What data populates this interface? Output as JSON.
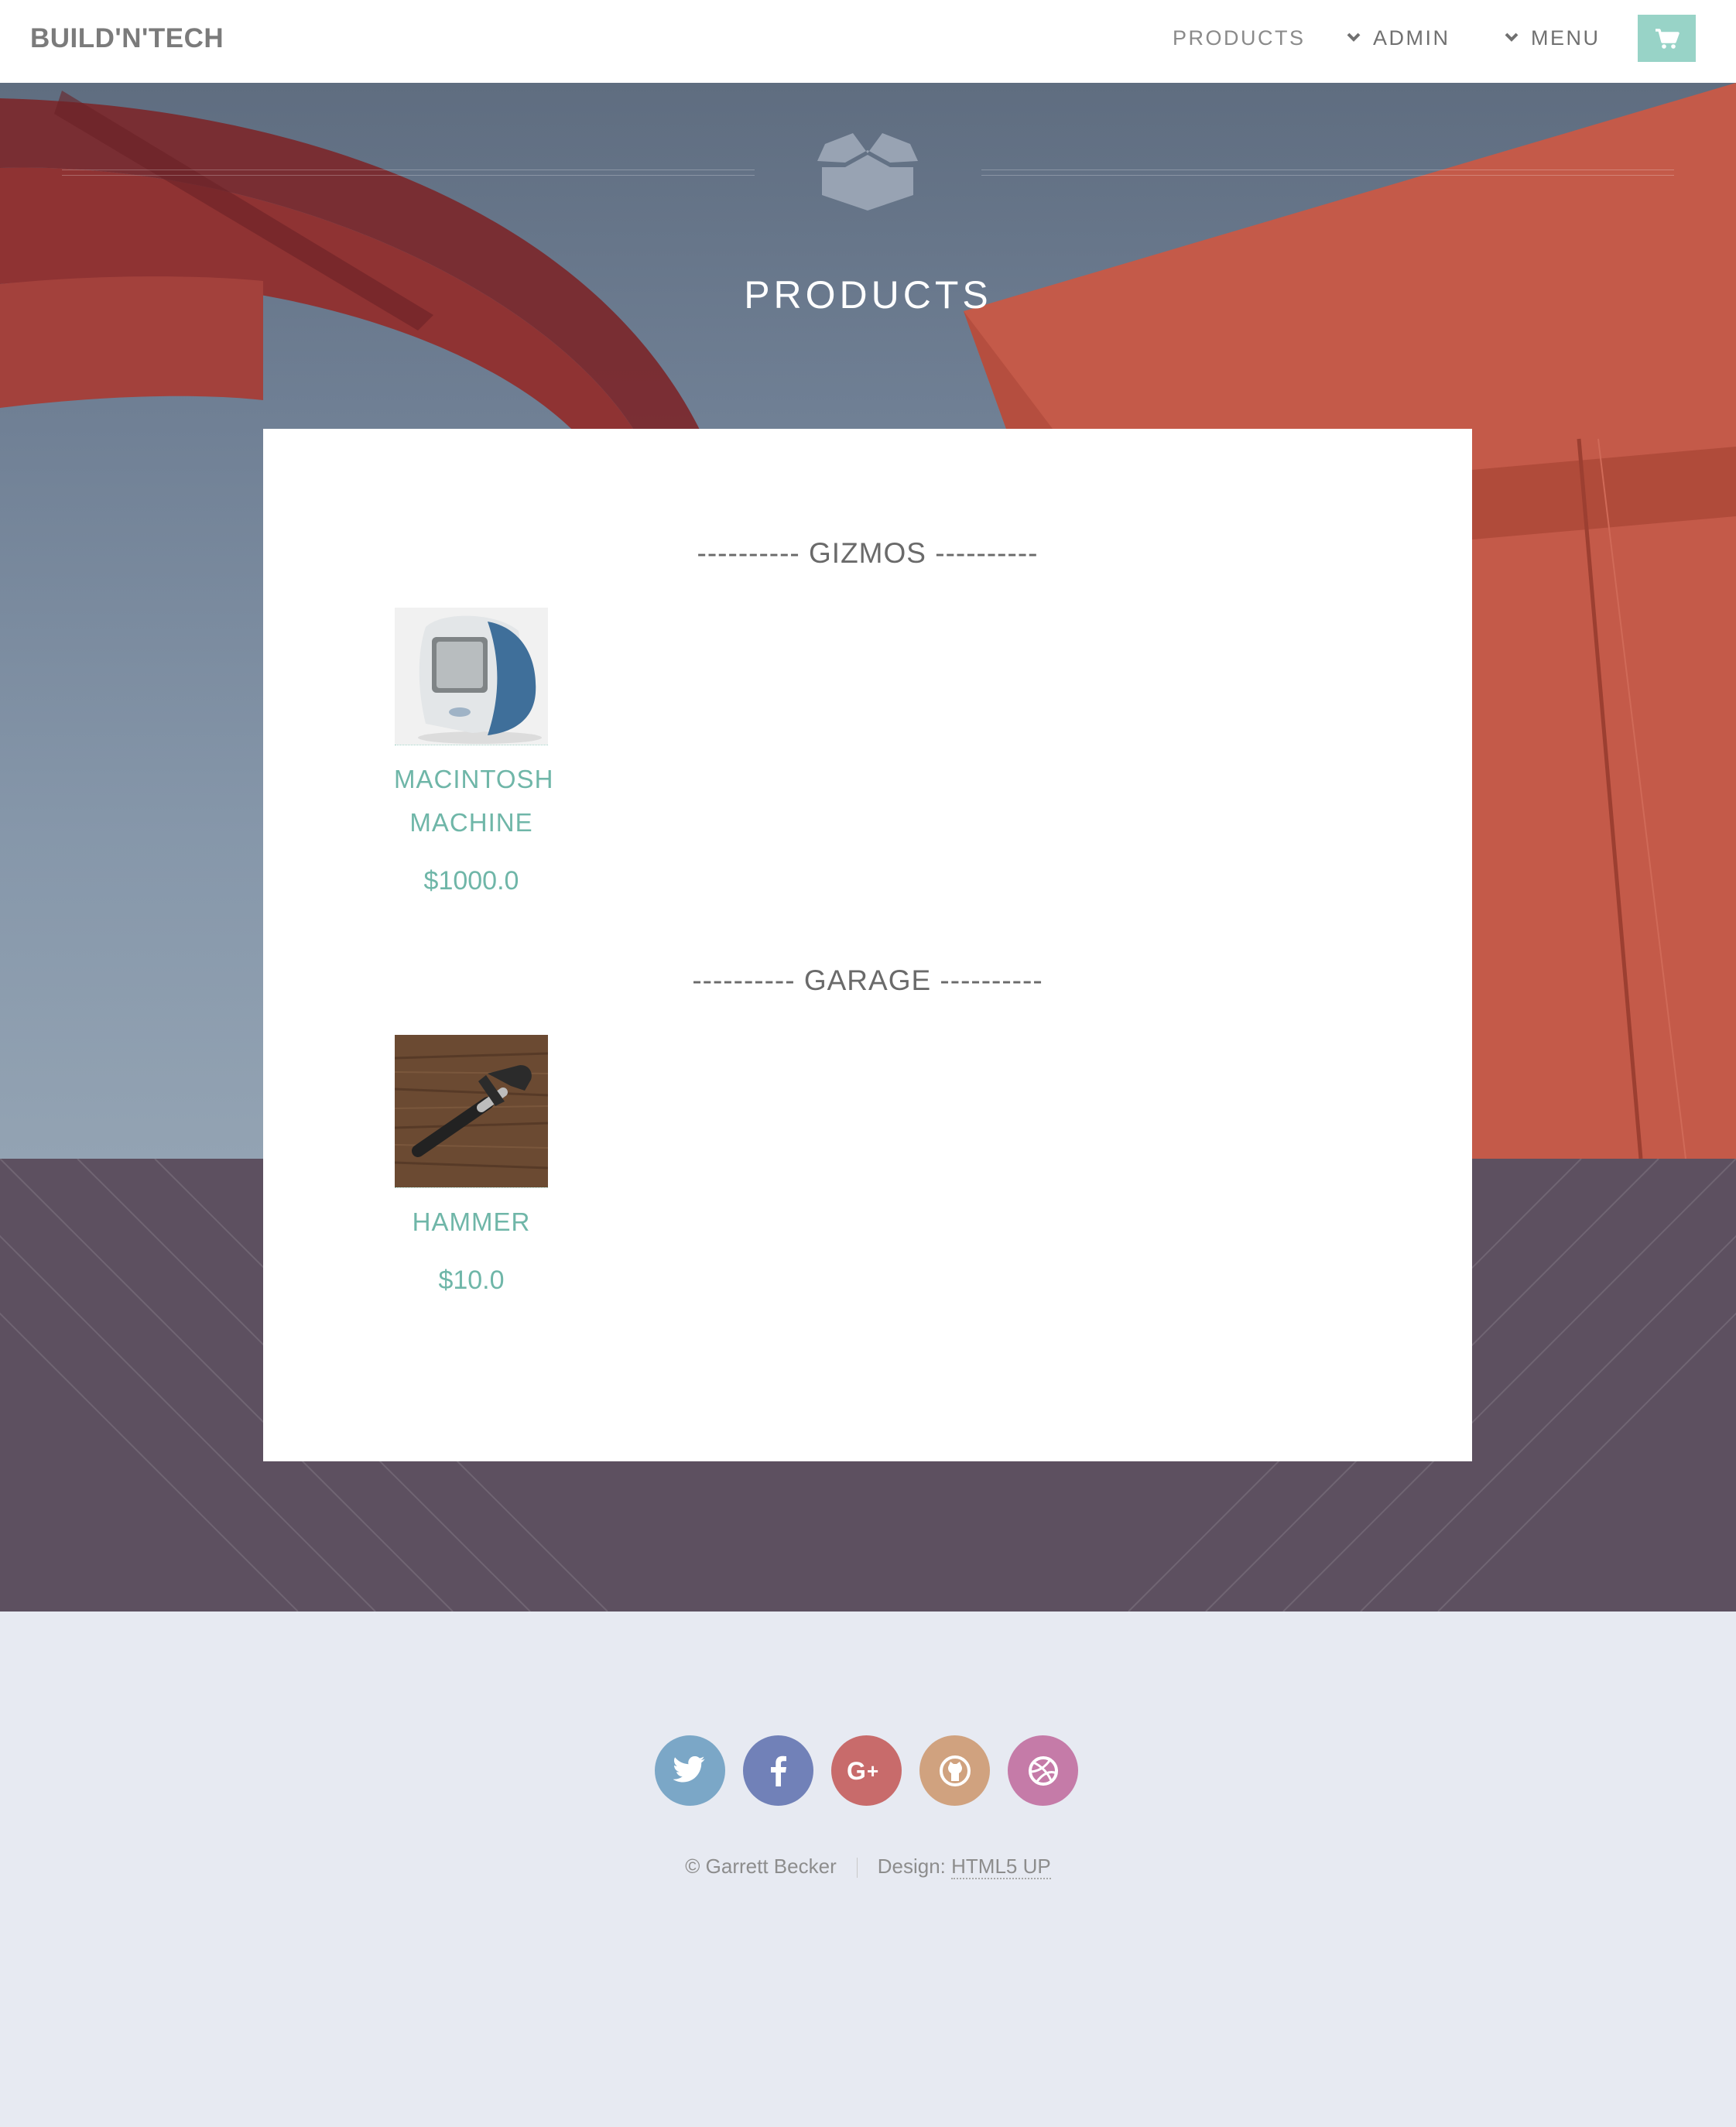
{
  "header": {
    "brand": "BUILD'N'TECH",
    "nav": {
      "products": "PRODUCTS",
      "admin": "ADMIN",
      "menu": "MENU"
    },
    "cart_icon": "cart-icon"
  },
  "hero": {
    "icon": "box-icon",
    "title": "PRODUCTS"
  },
  "categories": [
    {
      "heading": "---------- GIZMOS ----------",
      "products": [
        {
          "name_line1": "MACINTOSH",
          "name_line2": "MACHINE",
          "price": "$1000.0",
          "image": "imac-image"
        }
      ]
    },
    {
      "heading": "---------- GARAGE ----------",
      "products": [
        {
          "name_line1": "HAMMER",
          "price": "$10.0",
          "image": "hammer-image"
        }
      ]
    }
  ],
  "footer": {
    "socials": [
      {
        "icon": "twitter-icon",
        "color": "#7ba7c7"
      },
      {
        "icon": "facebook-icon",
        "color": "#7181b8"
      },
      {
        "icon": "google-plus-icon",
        "color": "#c86b6b"
      },
      {
        "icon": "github-icon",
        "color": "#d0a27f"
      },
      {
        "icon": "dribbble-icon",
        "color": "#c57ba8"
      }
    ],
    "copyright": "© Garrett Becker",
    "design_label": "Design:",
    "design_link": "HTML5 UP"
  },
  "colors": {
    "accent": "#98d3c7",
    "product_text": "#6fb6a8",
    "band": "#5d5060",
    "footer_bg": "#e7eaf2"
  }
}
